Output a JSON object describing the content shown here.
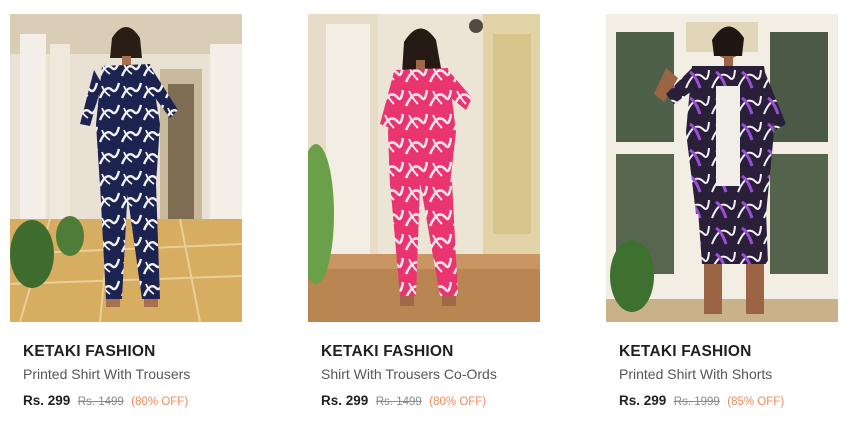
{
  "products": [
    {
      "brand": "KETAKI FASHION",
      "title": "Printed Shirt With Trousers",
      "price": "Rs. 299",
      "mrp": "Rs. 1499",
      "discount": "(80% OFF)",
      "image": "model-navy-printed-co-ord",
      "outfit_color": "#1c2350"
    },
    {
      "brand": "KETAKI FASHION",
      "title": "Shirt With Trousers Co-Ords",
      "price": "Rs. 299",
      "mrp": "Rs. 1499",
      "discount": "(80% OFF)",
      "image": "model-pink-printed-co-ord",
      "outfit_color": "#e8346f"
    },
    {
      "brand": "KETAKI FASHION",
      "title": "Printed Shirt With Shorts",
      "price": "Rs. 299",
      "mrp": "Rs. 1999",
      "discount": "(85% OFF)",
      "image": "model-purple-printed-shirt-shorts",
      "outfit_color": "#2a1f38"
    }
  ],
  "colors": {
    "brand_text": "#1f1f24",
    "title_text": "#55565c",
    "mrp_text": "#888a90",
    "discount_text": "#f0895a"
  }
}
